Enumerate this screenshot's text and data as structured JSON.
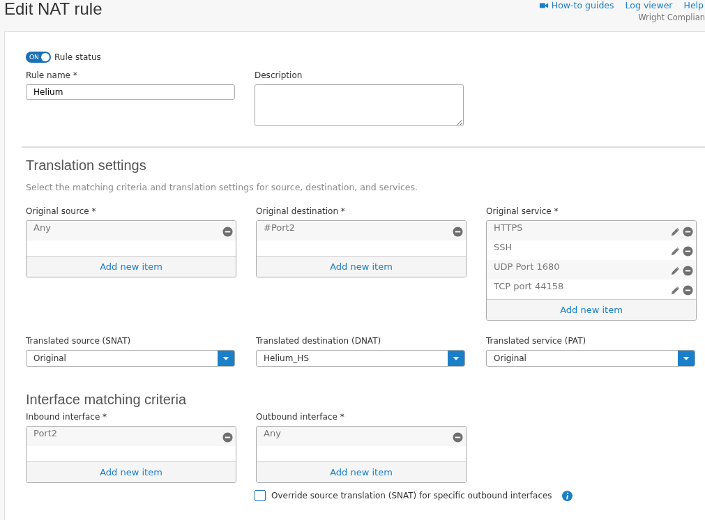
{
  "page": {
    "title": "Edit NAT rule",
    "links": [
      {
        "label": "How-to guides",
        "kind": "video"
      },
      {
        "label": "Log viewer",
        "kind": "plain"
      },
      {
        "label": "Help",
        "kind": "plain"
      }
    ],
    "account": "Wright Complian"
  },
  "rule_status": {
    "on_label": "ON",
    "label": "Rule status",
    "on": true
  },
  "rule_name": {
    "label": "Rule name *",
    "value": "Helium"
  },
  "description": {
    "label": "Description"
  },
  "translation": {
    "title": "Translation settings",
    "subtitle": "Select the matching criteria and translation settings for source, destination, and services.",
    "lists": [
      {
        "label": "Original source *",
        "add": "Add new item",
        "items": [
          {
            "text": "Any",
            "editable": false
          }
        ]
      },
      {
        "label": "Original destination *",
        "add": "Add new item",
        "items": [
          {
            "text": "#Port2",
            "editable": false
          }
        ]
      },
      {
        "label": "Original service *",
        "add": "Add new item",
        "items": [
          {
            "text": "HTTPS",
            "editable": true
          },
          {
            "text": "SSH",
            "editable": true
          },
          {
            "text": "UDP Port 1680",
            "editable": true
          },
          {
            "text": "TCP port 44158",
            "editable": true
          }
        ]
      }
    ],
    "selects": [
      {
        "label": "Translated source (SNAT)",
        "value": "Original"
      },
      {
        "label": "Translated destination (DNAT)",
        "value": "Helium_HS"
      },
      {
        "label": "Translated service (PAT)",
        "value": "Original"
      }
    ]
  },
  "interfaces": {
    "title": "Interface matching criteria",
    "lists": [
      {
        "label": "Inbound interface *",
        "add": "Add new item",
        "items": [
          {
            "text": "Port2",
            "editable": false
          }
        ]
      },
      {
        "label": "Outbound interface *",
        "add": "Add new item",
        "items": [
          {
            "text": "Any",
            "editable": false
          }
        ]
      }
    ],
    "override": {
      "label": "Override source translation (SNAT) for specific outbound interfaces",
      "checked": false
    }
  }
}
